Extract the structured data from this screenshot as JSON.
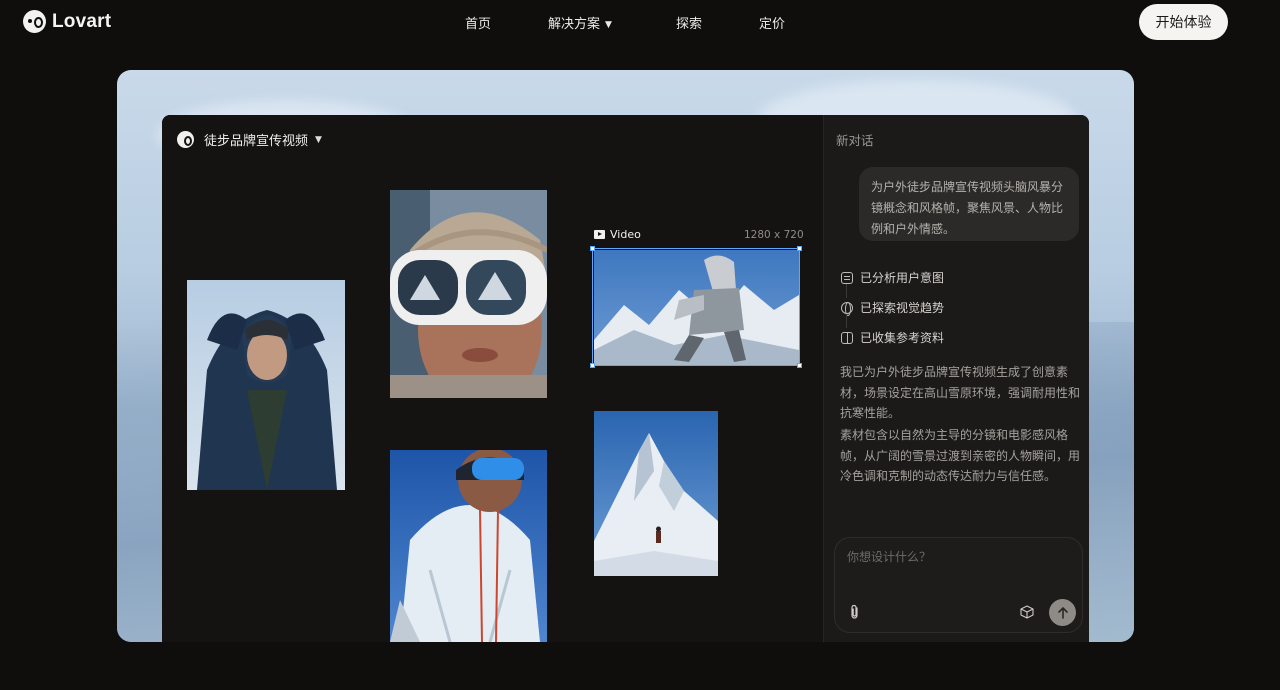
{
  "brand": {
    "name": "Lovart"
  },
  "nav": {
    "items": [
      {
        "label": "首页"
      },
      {
        "label": "解决方案"
      },
      {
        "label": "探索"
      },
      {
        "label": "定价"
      }
    ],
    "cta": "开始体验"
  },
  "project": {
    "title": "徒步品牌宣传视频"
  },
  "canvas": {
    "video_label": "Video",
    "video_size": "1280 x 720"
  },
  "chat": {
    "title": "新对话",
    "user_message": "为户外徒步品牌宣传视频头脑风暴分镜概念和风格帧，聚焦风景、人物比例和户外情感。",
    "steps": [
      {
        "icon": "document-icon",
        "label": "已分析用户意图"
      },
      {
        "icon": "globe-icon",
        "label": "已探索视觉趋势"
      },
      {
        "icon": "box-icon",
        "label": "已收集参考资料"
      }
    ],
    "reply_paragraphs": [
      "我已为户外徒步品牌宣传视频生成了创意素材，场景设定在高山雪原环境，强调耐用性和抗寒性能。",
      "素材包含以自然为主导的分镜和电影感风格帧，从广阔的雪景过渡到亲密的人物瞬间，用冷色调和克制的动态传达耐力与信任感。"
    ],
    "input_placeholder": "你想设计什么？"
  },
  "colors": {
    "page_bg": "#0f0e0d",
    "panel_bg": "#151413",
    "chat_bg": "#1b1a19",
    "selection": "#5aa8ff",
    "cta_bg": "#f6f4f0"
  }
}
